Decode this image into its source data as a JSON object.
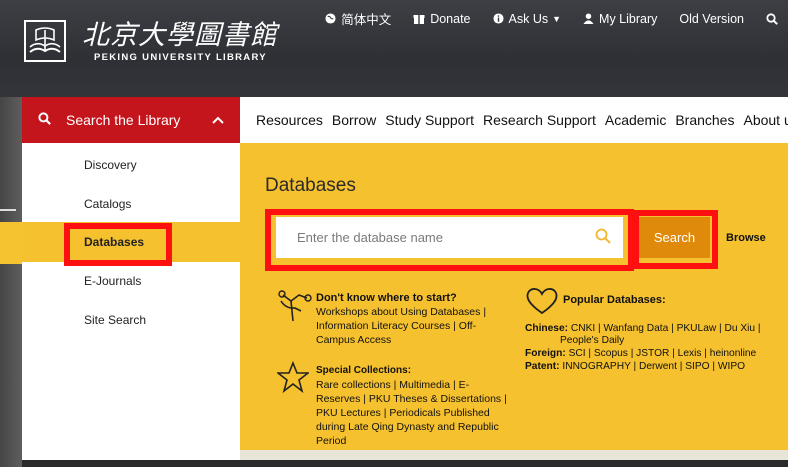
{
  "logo": {
    "name_cn": "北京大學圖書館",
    "name_en": "PEKING UNIVERSITY LIBRARY"
  },
  "topnav": [
    {
      "icon": "globe-icon",
      "label": "简体中文"
    },
    {
      "icon": "gift-icon",
      "label": "Donate"
    },
    {
      "icon": "info-icon",
      "label": "Ask Us"
    },
    {
      "icon": "user-icon",
      "label": "My Library"
    },
    {
      "icon": "",
      "label": "Old Version"
    }
  ],
  "search_library": {
    "label": "Search the Library",
    "menu": [
      "Discovery",
      "Catalogs",
      "Databases",
      "E-Journals",
      "Site Search"
    ],
    "active_index": 2
  },
  "mainnav": [
    "Resources",
    "Borrow",
    "Study Support",
    "Research Support",
    "Academic",
    "Branches",
    "About us"
  ],
  "panel": {
    "title": "Databases",
    "search_placeholder": "Enter the database name",
    "search_button": "Search",
    "browse": "Browse",
    "start": {
      "title": "Don't know where to start?",
      "lines": [
        "Workshops about Using Databases |",
        "Information Literacy Courses | Off-",
        "Campus Access"
      ]
    },
    "special": {
      "title": "Special Collections:",
      "lines": [
        "Rare collections | Multimedia | E-",
        "Reserves | PKU Theses & Dissertations |",
        "PKU Lectures | Periodicals Published",
        "during Late Qing Dynasty and Republic",
        "Period"
      ]
    },
    "popular": {
      "title": "Popular Databases:",
      "chinese_label": "Chinese:",
      "chinese_line1": "CNKI | Wanfang Data | PKULaw | Du Xiu |",
      "chinese_line2": "People's Daily",
      "foreign_label": "Foreign:",
      "foreign": "SCI | Scopus | JSTOR | Lexis | heinonline",
      "patent_label": "Patent:",
      "patent": "INNOGRAPHY | Derwent | SIPO | WIPO"
    }
  },
  "colors": {
    "red": "#c4151c",
    "yellow": "#f6c12e",
    "orange_button": "#e08a0c",
    "highlight_box": "#ff1010"
  }
}
